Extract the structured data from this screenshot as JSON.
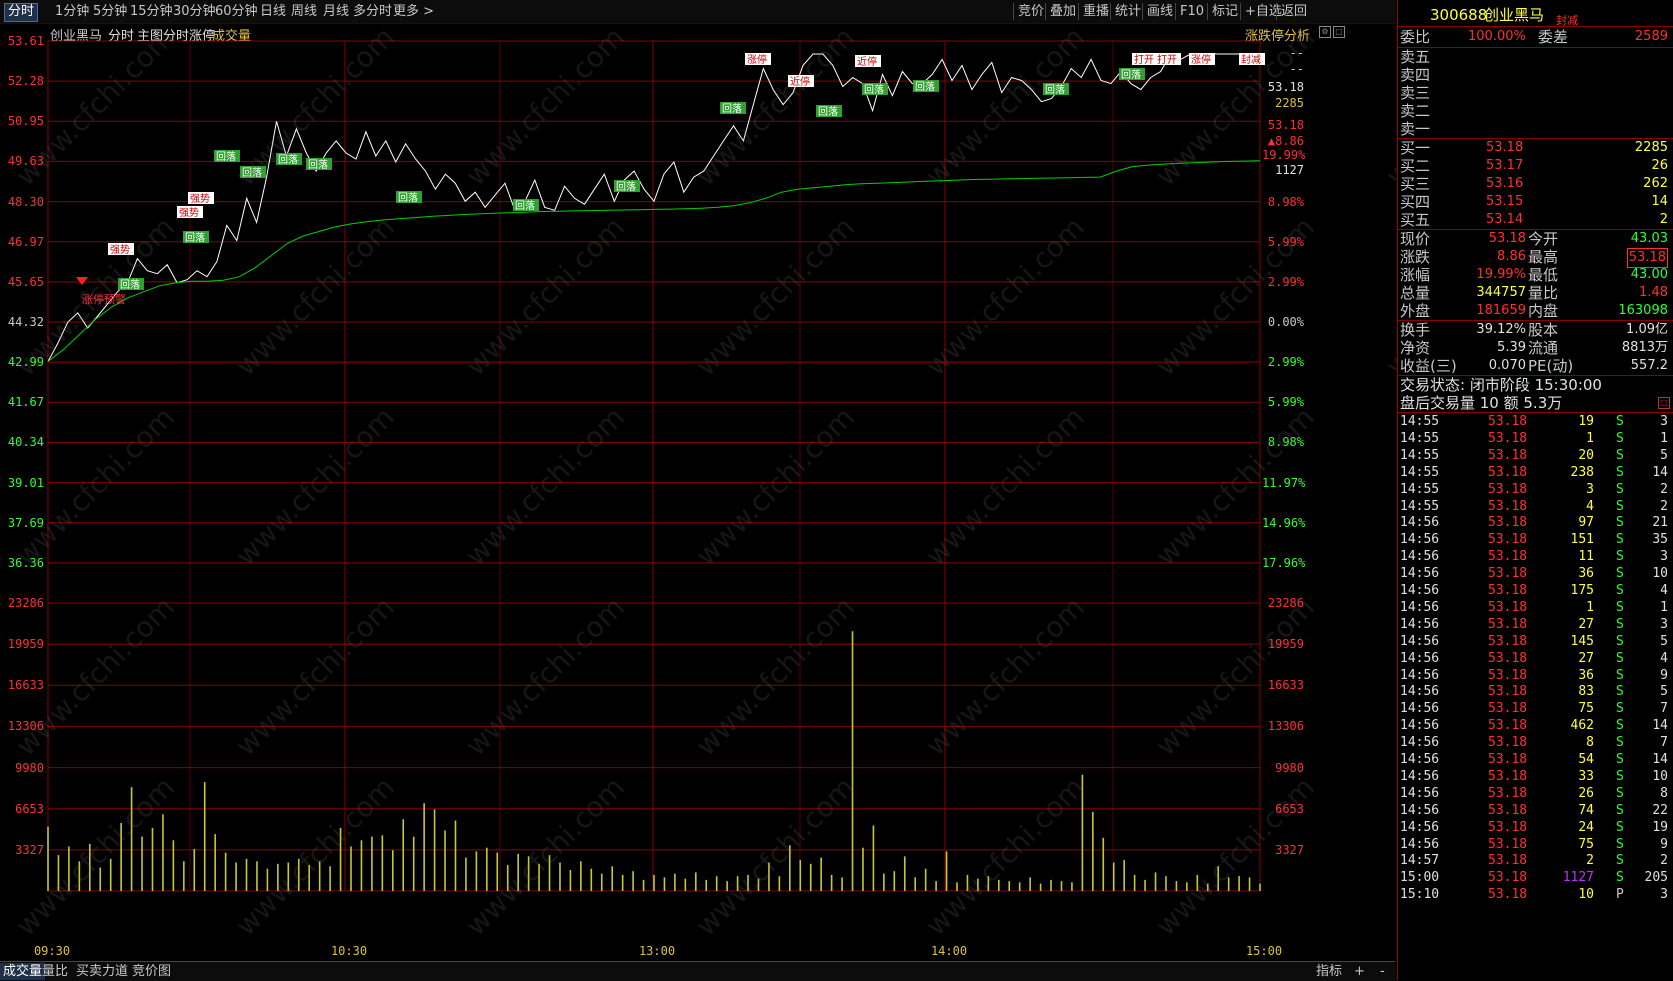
{
  "timeframes": [
    {
      "label": "分时",
      "active": true
    },
    {
      "label": "1分钟"
    },
    {
      "label": "5分钟"
    },
    {
      "label": "15分钟"
    },
    {
      "label": "30分钟"
    },
    {
      "label": "60分钟"
    },
    {
      "label": "日线"
    },
    {
      "label": "周线"
    },
    {
      "label": "月线"
    },
    {
      "label": "多分时"
    },
    {
      "label": "更多 >"
    }
  ],
  "tools": [
    "竞价",
    "叠加",
    "重播",
    "统计",
    "画线",
    "F10",
    "标记",
    "+自选",
    "返回"
  ],
  "chart_header": {
    "stock": "创业黑马",
    "mode": "分时",
    "indicator": "主图分时涨停",
    "volume_label": "成交量",
    "analysis": "涨跌停分析"
  },
  "price_axis": {
    "left": [
      "53.61",
      "52.28",
      "50.95",
      "49.63",
      "48.30",
      "46.97",
      "45.65",
      "44.32",
      "42.99",
      "41.67",
      "40.34",
      "39.01",
      "37.69",
      "36.36"
    ],
    "right": [
      "",
      "",
      "",
      "",
      "8.98%",
      "5.99%",
      "2.99%",
      "0.00%",
      "2.99%",
      "5.99%",
      "8.98%",
      "11.97%",
      "14.96%",
      "17.96%"
    ]
  },
  "price_readout": {
    "dashes1": "--",
    "dashes2": "--",
    "price": "53.18",
    "vol": "2285",
    "price2": "53.18",
    "change": "▲8.86",
    "pct": "19.99%",
    "lastvol": "1127"
  },
  "volume_axis": [
    "23286",
    "19959",
    "16633",
    "13306",
    "9980",
    "6653",
    "3327"
  ],
  "time_axis": [
    "09:30",
    "10:30",
    "13:00",
    "14:00",
    "15:00"
  ],
  "signal_labels": {
    "warn": "涨停预警",
    "strong": "强势",
    "pullback": "回落",
    "limit": "涨停",
    "near": "近停",
    "sealed": "封减",
    "open": "打开"
  },
  "colors": {
    "up": "#ff3030",
    "down": "#30ff30",
    "price_line": "#ffffff",
    "avg_line": "#00d000",
    "volume": "#c8c830",
    "grid": "#8b0000",
    "accent_yellow": "#ffff00",
    "purple": "#c030ff"
  },
  "chart_data": {
    "type": "line",
    "title": "创业黑马 分时",
    "ylabel": "",
    "xlabel": "",
    "prev_close": 44.32,
    "ylim": [
      36.36,
      53.61
    ],
    "x_ticks": [
      "09:30",
      "10:30",
      "13:00",
      "14:00",
      "15:00"
    ],
    "series": [
      {
        "name": "price",
        "values": [
          42.99,
          43.6,
          44.3,
          44.6,
          44.1,
          44.5,
          44.9,
          45.3,
          45.6,
          46.4,
          46.0,
          45.9,
          46.2,
          45.6,
          45.7,
          46.0,
          45.8,
          46.3,
          47.5,
          47.0,
          48.4,
          47.6,
          49.1,
          50.95,
          49.8,
          50.7,
          49.9,
          49.3,
          49.9,
          50.3,
          49.9,
          49.7,
          50.6,
          49.8,
          50.3,
          49.6,
          50.2,
          49.7,
          49.3,
          48.7,
          49.2,
          48.9,
          48.3,
          48.6,
          48.1,
          48.5,
          48.9,
          48.0,
          48.3,
          49.0,
          48.1,
          48.0,
          48.8,
          48.4,
          48.2,
          48.7,
          49.2,
          48.3,
          49.0,
          49.3,
          48.7,
          48.3,
          49.2,
          49.6,
          48.6,
          49.1,
          49.3,
          49.8,
          50.3,
          50.8,
          50.3,
          51.5,
          52.7,
          52.0,
          51.5,
          51.9,
          52.8,
          53.18,
          53.18,
          52.8,
          52.1,
          52.4,
          52.2,
          51.3,
          52.5,
          51.8,
          52.6,
          52.2,
          52.2,
          52.5,
          53.0,
          52.3,
          52.8,
          52.0,
          52.5,
          52.9,
          51.9,
          52.4,
          52.3,
          52.0,
          51.6,
          51.7,
          52.1,
          52.7,
          52.4,
          53.0,
          52.3,
          52.2,
          52.6,
          52.2,
          52.0,
          52.4,
          52.6,
          53.18,
          53.0,
          53.18,
          53.18,
          53.18,
          53.18,
          53.18,
          53.18,
          53.18,
          53.18
        ]
      },
      {
        "name": "avg",
        "values": [
          42.99,
          43.4,
          43.9,
          44.4,
          44.8,
          45.1,
          45.3,
          45.5,
          45.6,
          45.65,
          45.65,
          45.68,
          45.8,
          46.1,
          46.5,
          46.9,
          47.15,
          47.3,
          47.45,
          47.55,
          47.62,
          47.68,
          47.72,
          47.76,
          47.8,
          47.83,
          47.86,
          47.88,
          47.9,
          47.92,
          47.94,
          47.96,
          47.97,
          47.98,
          47.99,
          48.0,
          48.01,
          48.02,
          48.03,
          48.04,
          48.05,
          48.07,
          48.1,
          48.15,
          48.25,
          48.4,
          48.6,
          48.7,
          48.75,
          48.8,
          48.85,
          48.88,
          48.9,
          48.92,
          48.94,
          48.96,
          48.98,
          49.0,
          49.02,
          49.03,
          49.04,
          49.05,
          49.06,
          49.07,
          49.08,
          49.09,
          49.1,
          49.3,
          49.45,
          49.5,
          49.53,
          49.56,
          49.58,
          49.6,
          49.62,
          49.63,
          49.64
        ]
      },
      {
        "name": "volume",
        "values": [
          5200,
          2900,
          3600,
          2400,
          3800,
          1900,
          2600,
          5500,
          8400,
          4400,
          5100,
          6200,
          4100,
          2400,
          3400,
          8800,
          4600,
          3100,
          2300,
          2600,
          2400,
          1800,
          2200,
          2300,
          2600,
          2100,
          2400,
          2000,
          5100,
          3600,
          4100,
          4400,
          4500,
          3300,
          5800,
          4400,
          7100,
          6600,
          4900,
          5700,
          2700,
          3200,
          3500,
          3100,
          2100,
          3000,
          2800,
          2200,
          2900,
          2300,
          1700,
          2400,
          1800,
          1400,
          2000,
          1300,
          1600,
          900,
          1300,
          1100,
          1400,
          1000,
          1500,
          900,
          1200,
          800,
          1200,
          1300,
          1000,
          2300,
          1200,
          3700,
          2500,
          2200,
          2700,
          1300,
          1100,
          21000,
          3500,
          5300,
          1400,
          1600,
          2800,
          1100,
          1800,
          800,
          3200,
          700,
          1300,
          1000,
          1200,
          900,
          800,
          700,
          1100,
          600,
          900,
          800,
          700,
          9400,
          6400,
          4300,
          2300,
          2500,
          1300,
          900,
          1500,
          1200,
          800,
          700,
          1300,
          600,
          2000,
          1100,
          1200,
          1100,
          600
        ]
      }
    ]
  },
  "quote": {
    "code": "300688",
    "name": "创业黑马",
    "tag": "封减",
    "weibi_label": "委比",
    "weibi": "100.00%",
    "weicha_label": "委差",
    "weicha": "2589",
    "sells": [
      "卖五",
      "卖四",
      "卖三",
      "卖二",
      "卖一"
    ],
    "buys": [
      {
        "label": "买一",
        "price": "53.18",
        "vol": "2285"
      },
      {
        "label": "买二",
        "price": "53.17",
        "vol": "26"
      },
      {
        "label": "买三",
        "price": "53.16",
        "vol": "262"
      },
      {
        "label": "买四",
        "price": "53.15",
        "vol": "14"
      },
      {
        "label": "买五",
        "price": "53.14",
        "vol": "2"
      }
    ],
    "stats": [
      {
        "l1": "现价",
        "v1": "53.18",
        "l2": "今开",
        "v2": "43.03"
      },
      {
        "l1": "涨跌",
        "v1": "8.86",
        "l2": "最高",
        "v2": "53.18"
      },
      {
        "l1": "涨幅",
        "v1": "19.99%",
        "l2": "最低",
        "v2": "43.00"
      },
      {
        "l1": "总量",
        "v1": "344757",
        "l2": "量比",
        "v2": "1.48"
      },
      {
        "l1": "外盘",
        "v1": "181659",
        "l2": "内盘",
        "v2": "163098"
      }
    ],
    "fund": [
      {
        "l1": "换手",
        "v1": "39.12%",
        "l2": "股本",
        "v2": "1.09亿"
      },
      {
        "l1": "净资",
        "v1": "5.39",
        "l2": "流通",
        "v2": "8813万"
      },
      {
        "l1": "收益(三)",
        "v1": "0.070",
        "l2": "PE(动)",
        "v2": "557.2"
      }
    ],
    "status": "交易状态: 闭市阶段 15:30:00",
    "after": "盘后交易量 10 额 5.3万"
  },
  "ticks": [
    [
      "14:55",
      "53.18",
      "19",
      "S",
      "3"
    ],
    [
      "14:55",
      "53.18",
      "1",
      "S",
      "1"
    ],
    [
      "14:55",
      "53.18",
      "20",
      "S",
      "5"
    ],
    [
      "14:55",
      "53.18",
      "238",
      "S",
      "14"
    ],
    [
      "14:55",
      "53.18",
      "3",
      "S",
      "2"
    ],
    [
      "14:55",
      "53.18",
      "4",
      "S",
      "2"
    ],
    [
      "14:56",
      "53.18",
      "97",
      "S",
      "21"
    ],
    [
      "14:56",
      "53.18",
      "151",
      "S",
      "35"
    ],
    [
      "14:56",
      "53.18",
      "11",
      "S",
      "3"
    ],
    [
      "14:56",
      "53.18",
      "36",
      "S",
      "10"
    ],
    [
      "14:56",
      "53.18",
      "175",
      "S",
      "4"
    ],
    [
      "14:56",
      "53.18",
      "1",
      "S",
      "1"
    ],
    [
      "14:56",
      "53.18",
      "27",
      "S",
      "3"
    ],
    [
      "14:56",
      "53.18",
      "145",
      "S",
      "5"
    ],
    [
      "14:56",
      "53.18",
      "27",
      "S",
      "4"
    ],
    [
      "14:56",
      "53.18",
      "36",
      "S",
      "9"
    ],
    [
      "14:56",
      "53.18",
      "83",
      "S",
      "5"
    ],
    [
      "14:56",
      "53.18",
      "75",
      "S",
      "7"
    ],
    [
      "14:56",
      "53.18",
      "462",
      "S",
      "14"
    ],
    [
      "14:56",
      "53.18",
      "8",
      "S",
      "7"
    ],
    [
      "14:56",
      "53.18",
      "54",
      "S",
      "14"
    ],
    [
      "14:56",
      "53.18",
      "33",
      "S",
      "10"
    ],
    [
      "14:56",
      "53.18",
      "26",
      "S",
      "8"
    ],
    [
      "14:56",
      "53.18",
      "74",
      "S",
      "22"
    ],
    [
      "14:56",
      "53.18",
      "24",
      "S",
      "19"
    ],
    [
      "14:56",
      "53.18",
      "75",
      "S",
      "9"
    ],
    [
      "14:57",
      "53.18",
      "2",
      "S",
      "2"
    ],
    [
      "15:00",
      "53.18",
      "1127",
      "S",
      "205"
    ],
    [
      "15:10",
      "53.18",
      "10",
      "P",
      "3"
    ]
  ],
  "bottom_tabs": [
    "成交量",
    "量比",
    "买卖力道",
    "竞价图"
  ],
  "bottom_right": {
    "indicator": "指标",
    "plus": "+",
    "minus": "-"
  },
  "watermark": "www.cfchi.com"
}
